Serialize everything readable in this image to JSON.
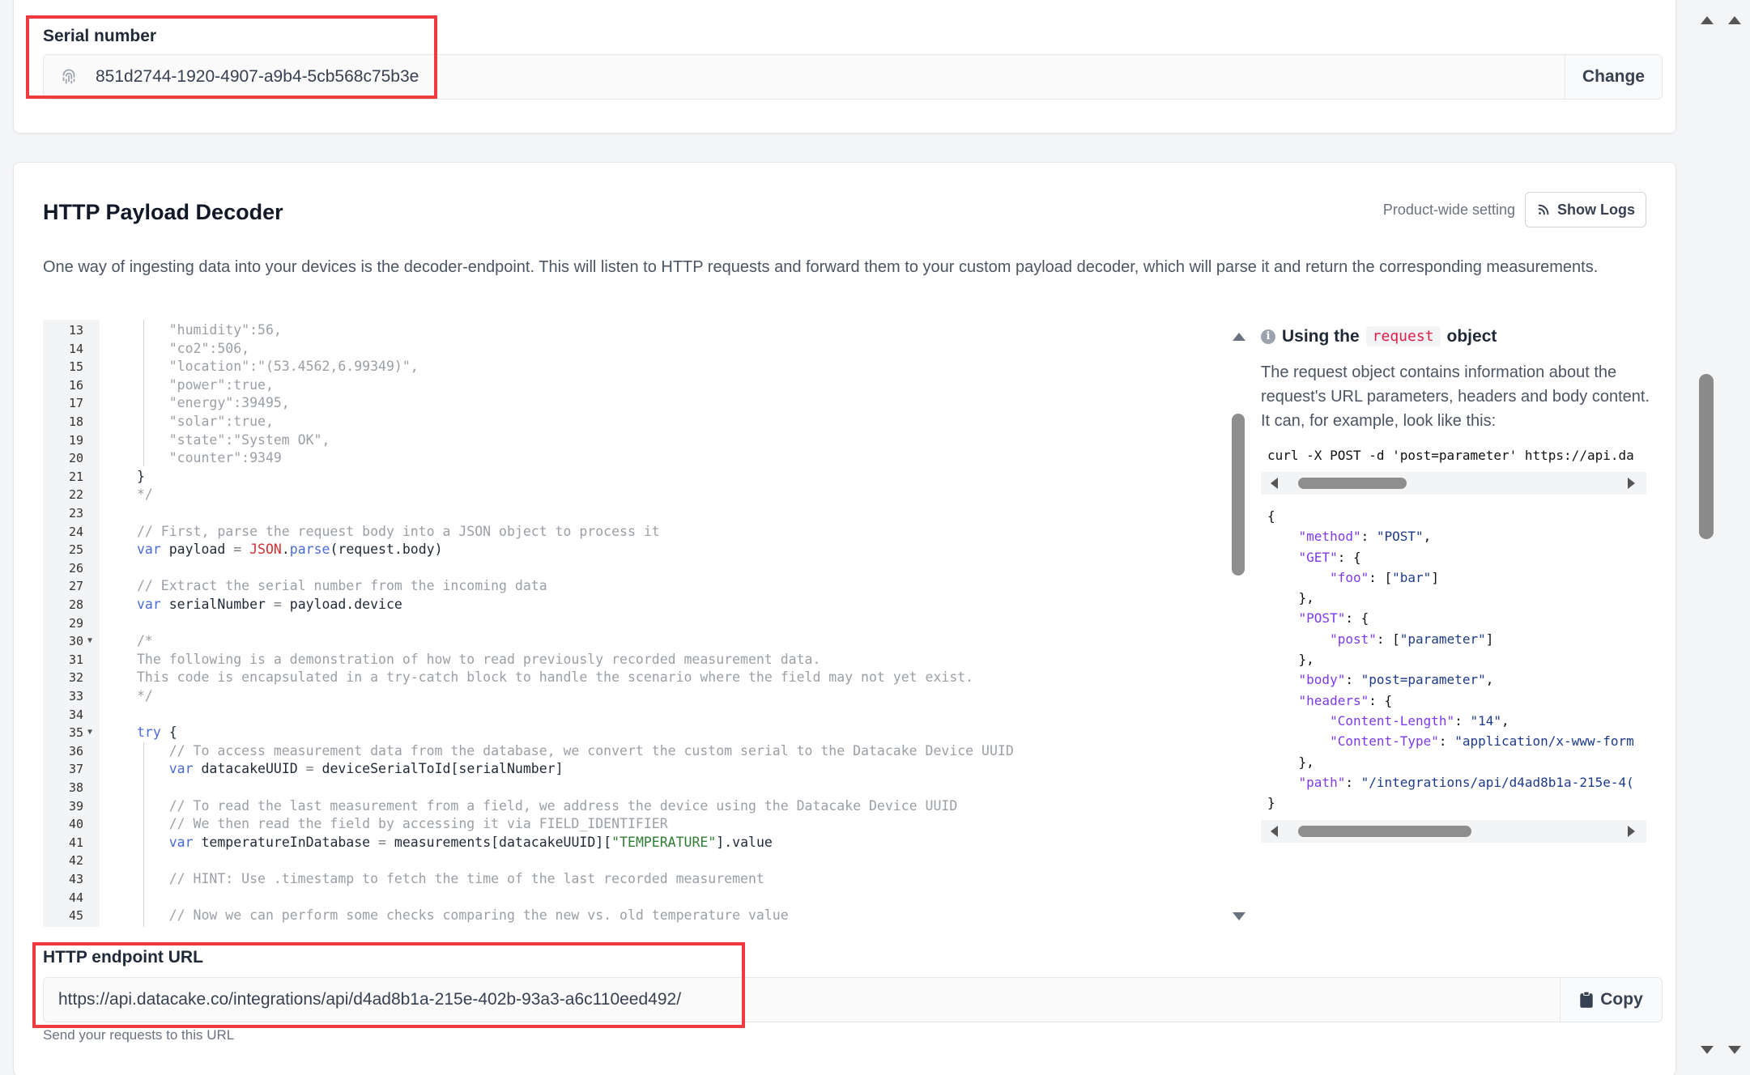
{
  "serial_section": {
    "label": "Serial number",
    "value": "851d2744-1920-4907-a9b4-5cb568c75b3e",
    "change_button": "Change",
    "icon": "fingerprint-icon"
  },
  "decoder": {
    "title": "HTTP Payload Decoder",
    "product_wide": "Product-wide setting",
    "show_logs_button": "Show Logs",
    "description": "One way of ingesting data into your devices is the decoder-endpoint. This will listen to HTTP requests and forward them to your custom payload decoder, which will parse it and return the corresponding measurements."
  },
  "code_lines": [
    {
      "n": "13",
      "text": "    \"humidity\":56,"
    },
    {
      "n": "14",
      "text": "    \"co2\":506,"
    },
    {
      "n": "15",
      "text": "    \"location\":\"(53.4562,6.99349)\","
    },
    {
      "n": "16",
      "text": "    \"power\":true,"
    },
    {
      "n": "17",
      "text": "    \"energy\":39495,"
    },
    {
      "n": "18",
      "text": "    \"solar\":true,"
    },
    {
      "n": "19",
      "text": "    \"state\":\"System OK\","
    },
    {
      "n": "20",
      "text": "    \"counter\":9349"
    },
    {
      "n": "21",
      "text": "}"
    },
    {
      "n": "22",
      "text": "*/"
    },
    {
      "n": "23",
      "text": ""
    },
    {
      "n": "24",
      "text": "// First, parse the request body into a JSON object to process it"
    },
    {
      "n": "25",
      "text": "var payload = JSON.parse(request.body)"
    },
    {
      "n": "26",
      "text": ""
    },
    {
      "n": "27",
      "text": "// Extract the serial number from the incoming data"
    },
    {
      "n": "28",
      "text": "var serialNumber = payload.device"
    },
    {
      "n": "29",
      "text": ""
    },
    {
      "n": "30",
      "text": "/*"
    },
    {
      "n": "31",
      "text": "The following is a demonstration of how to read previously recorded measurement data."
    },
    {
      "n": "32",
      "text": "This code is encapsulated in a try-catch block to handle the scenario where the field may not yet exist."
    },
    {
      "n": "33",
      "text": "*/"
    },
    {
      "n": "34",
      "text": ""
    },
    {
      "n": "35",
      "text": "try {"
    },
    {
      "n": "36",
      "text": "    // To access measurement data from the database, we convert the custom serial to the Datacake Device UUID"
    },
    {
      "n": "37",
      "text": "    var datacakeUUID = deviceSerialToId[serialNumber]"
    },
    {
      "n": "38",
      "text": ""
    },
    {
      "n": "39",
      "text": "    // To read the last measurement from a field, we address the device using the Datacake Device UUID"
    },
    {
      "n": "40",
      "text": "    // We then read the field by accessing it via FIELD_IDENTIFIER"
    },
    {
      "n": "41",
      "text": "    var temperatureInDatabase = measurements[datacakeUUID][\"TEMPERATURE\"].value"
    },
    {
      "n": "42",
      "text": ""
    },
    {
      "n": "43",
      "text": "    // HINT: Use .timestamp to fetch the time of the last recorded measurement"
    },
    {
      "n": "44",
      "text": ""
    },
    {
      "n": "45",
      "text": "    // Now we can perform some checks comparing the new vs. old temperature value"
    }
  ],
  "help": {
    "heading_prefix": "Using the",
    "heading_code": "request",
    "heading_suffix": "object",
    "text": "The request object contains information about the request's URL parameters, headers and body content. It can, for example, look like this:",
    "curl": "curl -X POST -d 'post=parameter' https://api.da",
    "json_lines": [
      "{",
      "    \"method\": \"POST\",",
      "    \"GET\": {",
      "        \"foo\": [\"bar\"]",
      "    },",
      "    \"POST\": {",
      "        \"post\": [\"parameter\"]",
      "    },",
      "    \"body\": \"post=parameter\",",
      "    \"headers\": {",
      "        \"Content-Length\": \"14\",",
      "        \"Content-Type\": \"application/x-www-form",
      "    },",
      "    \"path\": \"/integrations/api/d4ad8b1a-215e-4(",
      "}"
    ]
  },
  "endpoint": {
    "label": "HTTP endpoint URL",
    "url": "https://api.datacake.co/integrations/api/d4ad8b1a-215e-402b-93a3-a6c110eed492/",
    "copy_button": "Copy",
    "help": "Send your requests to this URL"
  },
  "colors": {
    "highlight": "#ef3b3f",
    "keyword": "#4b6bd6",
    "comment": "#9aa0a6",
    "accent_red": "#e11d48"
  }
}
